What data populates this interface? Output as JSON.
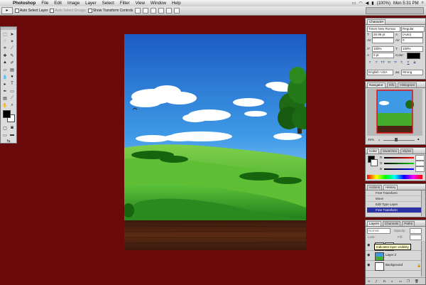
{
  "menubar": {
    "items": [
      "Photoshop",
      "File",
      "Edit",
      "Image",
      "Layer",
      "Select",
      "Filter",
      "View",
      "Window",
      "Help"
    ],
    "battery": "(100%)",
    "clock": "Mon 5:31 PM"
  },
  "options_bar": {
    "auto_select_layer": "Auto Select Layer",
    "auto_select_groups": "Auto Select Groups",
    "show_transform_controls": "Show Transform Controls"
  },
  "character": {
    "tab": "Character",
    "font_family": "Times New Roman",
    "font_style": "Regular",
    "font_size": "26.95 pt",
    "leading": "(Auto)",
    "tracking": "0",
    "vertical_scale": "100%",
    "horizontal_scale": "100%",
    "baseline_shift": "0 pt",
    "color_label": "Color:",
    "language": "English: USA",
    "anti_alias": "aa",
    "anti_alias_value": "Strong",
    "style_buttons": [
      "T",
      "T",
      "TT",
      "Tr",
      "T¹",
      "T,",
      "T",
      "T"
    ]
  },
  "navigator": {
    "tabs": [
      "Navigator",
      "Info",
      "Histogram"
    ],
    "zoom": "45%"
  },
  "color_panel": {
    "tabs": [
      "Color",
      "Swatches",
      "Styles"
    ],
    "channels": [
      "R",
      "G",
      "B"
    ]
  },
  "history": {
    "tabs": [
      "Actions",
      "History"
    ],
    "rows": [
      "Free Transform",
      "Move",
      "Edit Type Layer",
      "Free Transform"
    ]
  },
  "layers": {
    "tabs": [
      "Layers",
      "Channels",
      "Paths"
    ],
    "blend_mode": "Normal",
    "opacity_label": "Opacity:",
    "fill_label": "Fill:",
    "lock_label": "Lock:",
    "rows": [
      {
        "name": "Shape 2"
      },
      {
        "name": "Layer 2"
      },
      {
        "name": "Background"
      }
    ],
    "tooltip": "Indicates layer visibility"
  },
  "colors": {
    "menubar": "#e6e6e6",
    "canvas_bg": "#6b0a0a",
    "history_selected": "#2a31a5",
    "sky_top": "#1f63c8",
    "grass": "#3aa72c",
    "wood": "#4a2414"
  }
}
